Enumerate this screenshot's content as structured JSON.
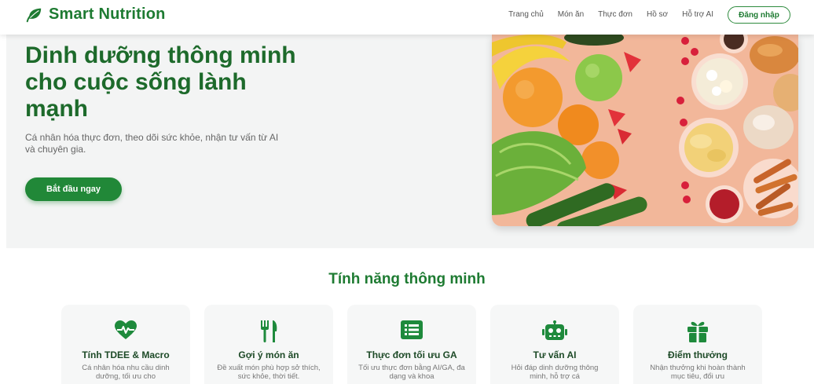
{
  "brand": {
    "name": "Smart Nutrition",
    "icon": "leaf-icon",
    "color": "#1e7b32"
  },
  "nav": {
    "links": [
      "Trang chủ",
      "Món ăn",
      "Thực đơn",
      "Hồ sơ",
      "Hỗ trợ AI"
    ],
    "login_label": "Đăng nhập"
  },
  "hero": {
    "title": "Dinh dưỡng thông minh cho cuộc sống lành mạnh",
    "subtitle": "Cá nhân hóa thực đơn, theo dõi sức khỏe, nhận tư vấn từ AI và chuyên gia.",
    "cta_label": "Bắt đầu ngay",
    "image": "fruits-vegetables-snacks-photo"
  },
  "features": {
    "title": "Tính năng thông minh",
    "cards": [
      {
        "icon": "heartbeat-icon",
        "title": "Tính TDEE & Macro",
        "desc": "Cá nhân hóa nhu cầu dinh dưỡng, tối ưu cho"
      },
      {
        "icon": "utensils-icon",
        "title": "Gợi ý món ăn",
        "desc": "Đề xuất món phù hợp sở thích, sức khỏe, thời tiết."
      },
      {
        "icon": "list-icon",
        "title": "Thực đơn tối ưu GA",
        "desc": "Tối ưu thực đơn bằng AI/GA, đa dạng và khoa"
      },
      {
        "icon": "robot-icon",
        "title": "Tư vấn AI",
        "desc": "Hỏi đáp dinh dưỡng thông minh, hỗ trợ cá"
      },
      {
        "icon": "gift-icon",
        "title": "Điểm thưởng",
        "desc": "Nhận thưởng khi hoàn thành mục tiêu, đổi ưu"
      }
    ]
  }
}
